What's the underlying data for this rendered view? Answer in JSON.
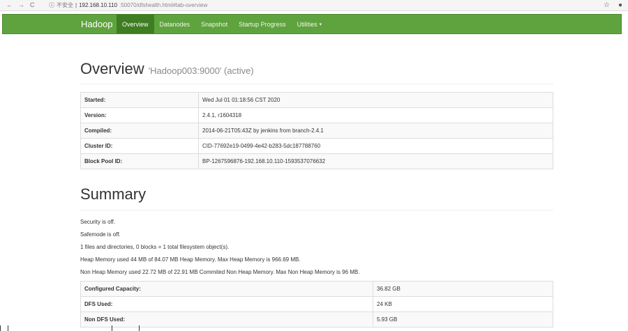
{
  "browser": {
    "insecure_label": "不安全",
    "url_host": "192.168.10.110",
    "url_rest": ":50070/dfshealth.html#tab-overview"
  },
  "navbar": {
    "brand": "Hadoop",
    "items": [
      {
        "label": "Overview",
        "active": true
      },
      {
        "label": "Datanodes"
      },
      {
        "label": "Snapshot"
      },
      {
        "label": "Startup Progress"
      },
      {
        "label": "Utilities"
      }
    ],
    "color": "#5fa33e",
    "active_color": "#3f7d22"
  },
  "overview": {
    "title": "Overview",
    "subtitle": "'Hadoop003:9000' (active)",
    "rows": [
      {
        "key": "Started:",
        "value": "Wed Jul 01 01:18:56 CST 2020"
      },
      {
        "key": "Version:",
        "value": "2.4.1, r1604318"
      },
      {
        "key": "Compiled:",
        "value": "2014-06-21T05:43Z by jenkins from branch-2.4.1"
      },
      {
        "key": "Cluster ID:",
        "value": "CID-77692e19-0499-4e42-b283-5dc187788760"
      },
      {
        "key": "Block Pool ID:",
        "value": "BP-1267596876-192.168.10.110-1593537076632"
      }
    ]
  },
  "summary": {
    "title": "Summary",
    "lines": [
      "Security is off.",
      "Safemode is off.",
      "1 files and directories, 0 blocks = 1 total filesystem object(s).",
      "Heap Memory used 44 MB of 84.07 MB Heap Memory. Max Heap Memory is 966.69 MB.",
      "Non Heap Memory used 22.72 MB of 22.91 MB Commited Non Heap Memory. Max Non Heap Memory is 96 MB."
    ],
    "rows": [
      {
        "key": "Configured Capacity:",
        "value": "36.82 GB"
      },
      {
        "key": "DFS Used:",
        "value": "24 KB"
      },
      {
        "key": "Non DFS Used:",
        "value": "5.93 GB"
      }
    ]
  }
}
